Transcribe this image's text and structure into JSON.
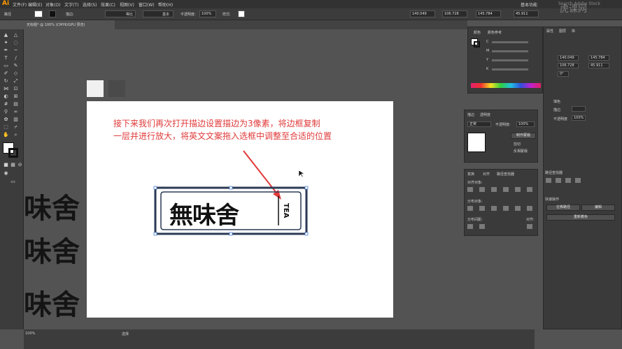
{
  "app": {
    "logo": "Ai",
    "workspace": "基本功能",
    "search_placeholder": "Search Adobe Stock",
    "watermark": "虎课网"
  },
  "menu": [
    "文件(F)",
    "编辑(E)",
    "对象(O)",
    "文字(T)",
    "选择(S)",
    "效果(C)",
    "视图(V)",
    "窗口(W)",
    "帮助(H)"
  ],
  "control": {
    "mode": "路径",
    "stroke_label": "描边:",
    "stroke_weight": "",
    "brush_label": "等比",
    "basic_label": "基本",
    "opacity_label": "不透明度:",
    "opacity_value": "100%",
    "style_label": "样式:",
    "x": "140.049",
    "y": "106.728",
    "w": "145.784",
    "h": "45.911"
  },
  "document": {
    "tab": "无标题* @ 100% (CMYK/GPU 预览)",
    "zoom": "100%",
    "status_tool": "选择"
  },
  "annotation": {
    "line1": "接下来我们再次打开描边设置描边为3像素，将边框复制",
    "line2": "一层并进行放大，将英文文案拖入选框中调整至合适的位置"
  },
  "logo_art": {
    "chinese": "無味舍",
    "english": "TEA"
  },
  "bg_text": [
    "味舍",
    "味舍",
    "味舍"
  ],
  "color_panel": {
    "tabs": [
      "颜色",
      "颜色参考"
    ],
    "channels": [
      "C",
      "M",
      "Y",
      "K"
    ]
  },
  "transparency_panel": {
    "tabs": [
      "描边",
      "透明度"
    ],
    "blend": "正常",
    "opacity_label": "不透明度:",
    "opacity": "100%",
    "make_mask": "制作蒙版",
    "clip": "剪切",
    "invert": "反相蒙版"
  },
  "align_panel": {
    "tabs": [
      "变换",
      "对齐",
      "路径查找器"
    ],
    "align_objects": "对齐对象:",
    "distribute_objects": "分布对象:",
    "distribute_spacing": "分布间距:",
    "align_to": "对齐:"
  },
  "props_panel": {
    "tabs": [
      "属性",
      "图层",
      "库"
    ],
    "x": "140.049",
    "y": "106.728",
    "w": "145.784",
    "h": "45.911",
    "angle": "0°",
    "fill": "填色",
    "stroke": "描边",
    "opacity": "不透明度",
    "opacity_value": "100%",
    "quick_actions": "快速操作",
    "offset_path": "位移路径",
    "edit": "编辑",
    "recolor": "重新着色",
    "pathfinder": "路径查找器"
  }
}
